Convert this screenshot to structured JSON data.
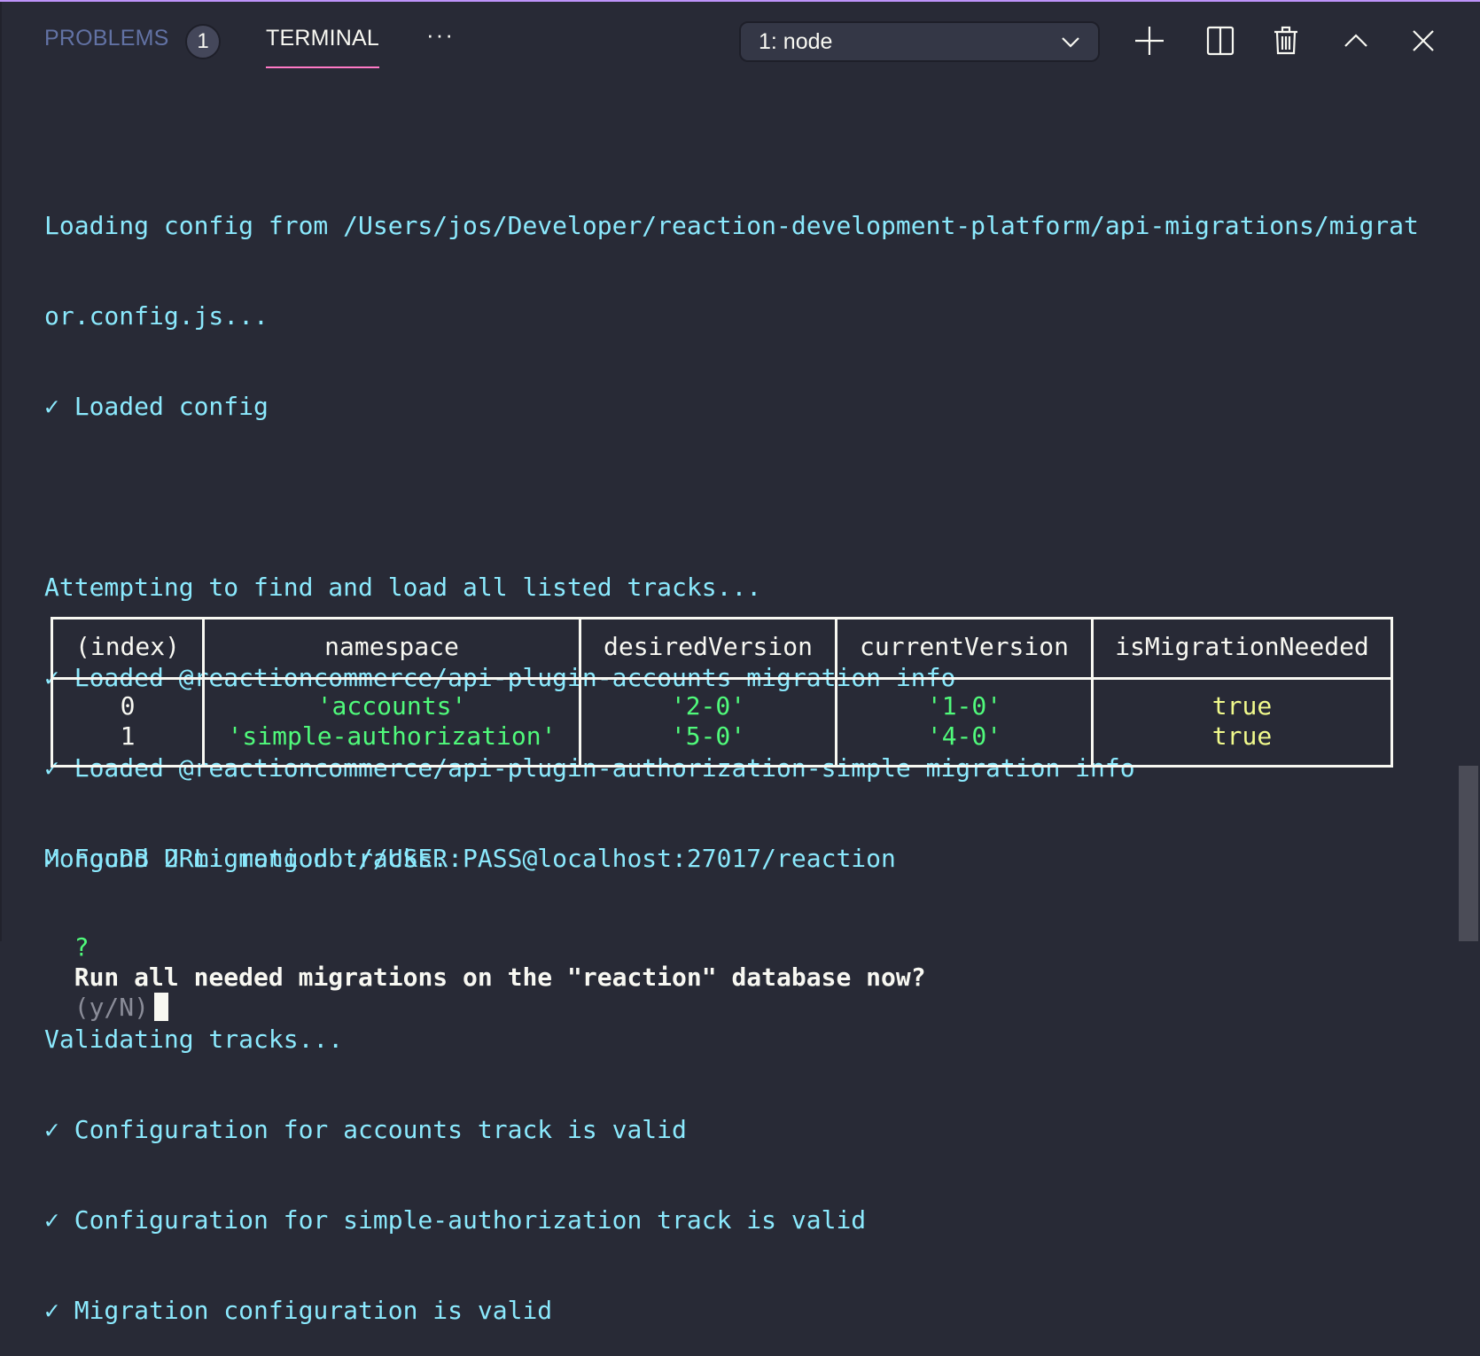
{
  "panel": {
    "tabs": [
      {
        "label": "PROBLEMS",
        "badge": "1",
        "active": false
      },
      {
        "label": "TERMINAL",
        "active": true
      }
    ],
    "more_label": "···",
    "terminal_select": {
      "value": "1: node"
    },
    "actions": [
      {
        "name": "new-terminal",
        "icon": "plus-icon"
      },
      {
        "name": "split-terminal",
        "icon": "split-icon"
      },
      {
        "name": "kill-terminal",
        "icon": "trash-icon"
      },
      {
        "name": "maximize-panel",
        "icon": "chevron-up-icon"
      },
      {
        "name": "close-panel",
        "icon": "close-icon"
      }
    ]
  },
  "colors": {
    "accent_top": "#bd93f9",
    "tab_underline": "#ff79c6",
    "output_text": "#8be9fd",
    "string_value": "#50fa7b",
    "boolean_value": "#f1fa8c",
    "background": "#282a36"
  },
  "terminal": {
    "lines": [
      "Loading config from /Users/jos/Developer/reaction-development-platform/api-migrations/migrat",
      "or.config.js...",
      "✓ Loaded config",
      "",
      "Attempting to find and load all listed tracks...",
      "✓ Loaded @reactioncommerce/api-plugin-accounts migration info",
      "✓ Loaded @reactioncommerce/api-plugin-authorization-simple migration info",
      "✓ Found 2 migration tracks.",
      "",
      "Validating tracks...",
      "✓ Configuration for accounts track is valid",
      "✓ Configuration for simple-authorization track is valid",
      "✓ Migration configuration is valid"
    ],
    "table": {
      "headers": [
        "(index)",
        "namespace",
        "desiredVersion",
        "currentVersion",
        "isMigrationNeeded"
      ],
      "rows": [
        [
          "0",
          "'accounts'",
          "'2-0'",
          "'1-0'",
          "true"
        ],
        [
          "1",
          "'simple-authorization'",
          "'5-0'",
          "'4-0'",
          "true"
        ]
      ]
    },
    "mongo_line": "MongoDB URL: mongodb://USER:PASS@localhost:27017/reaction",
    "prompt": {
      "marker": "?",
      "question": "Run all needed migrations on the \"reaction\" database now?",
      "hint": "(y/N)"
    }
  }
}
